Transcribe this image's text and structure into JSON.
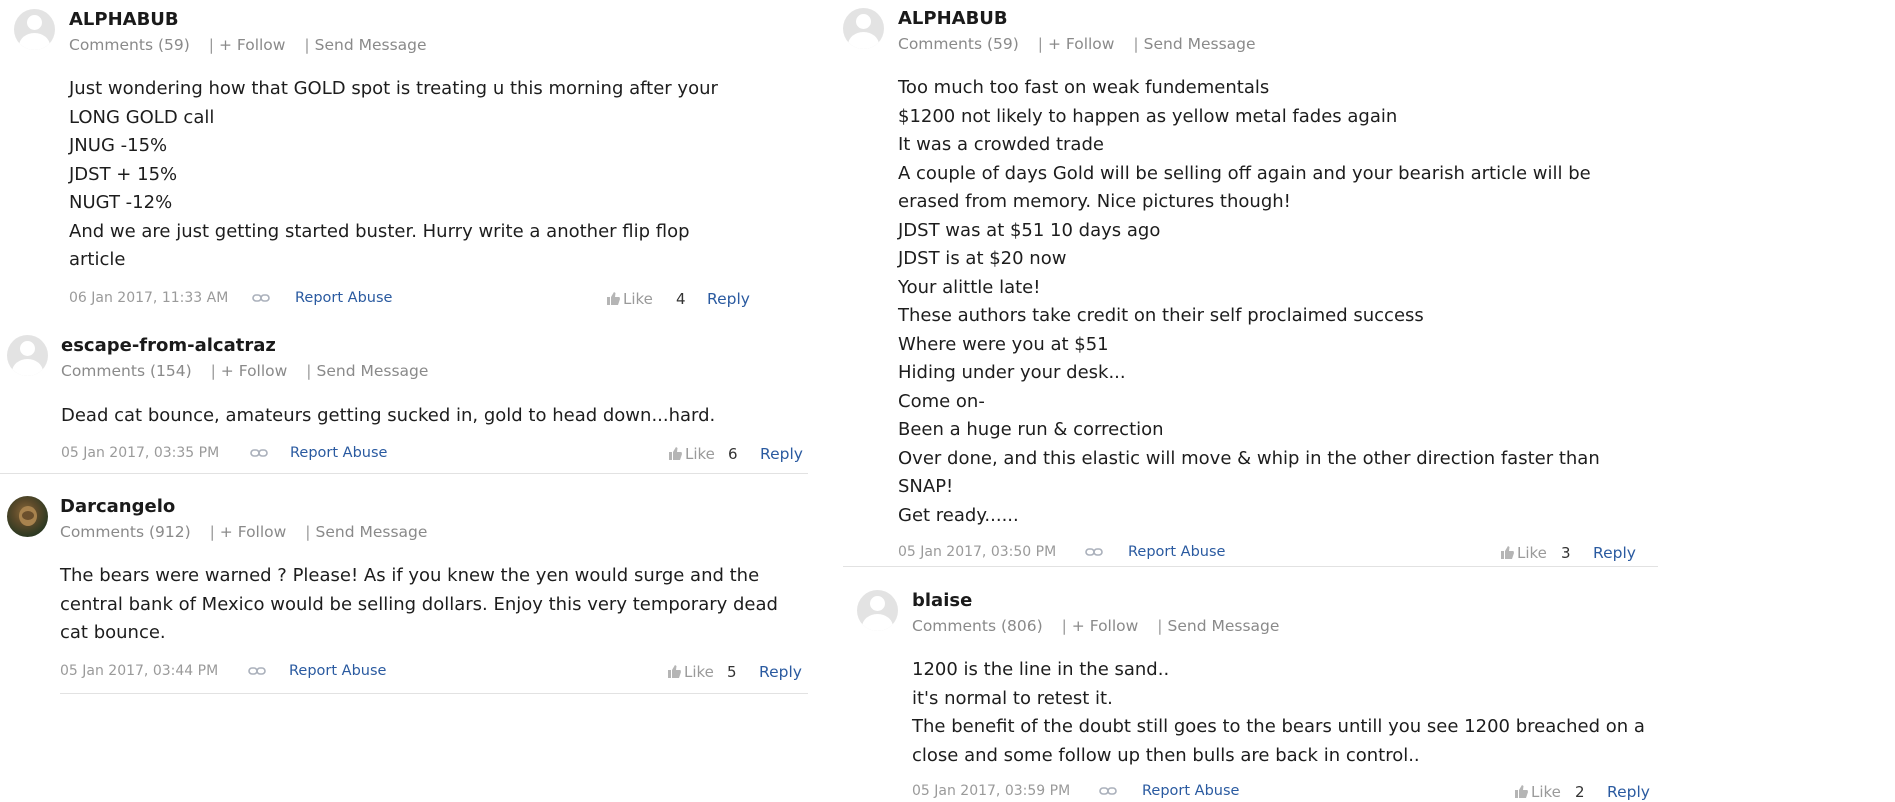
{
  "actions": {
    "follow": "+ Follow",
    "send_message": "Send Message",
    "report_abuse": "Report Abuse",
    "like": "Like",
    "reply": "Reply",
    "separator": "|"
  },
  "comments": [
    {
      "author": "ALPHABUB",
      "comment_count": "Comments (59)",
      "body": [
        "Just wondering how that GOLD spot is treating u this morning after your",
        "LONG GOLD call",
        "JNUG -15%",
        "JDST + 15%",
        "NUGT -12%",
        "And we are just getting started buster. Hurry write a another flip flop",
        "article"
      ],
      "timestamp": "06 Jan 2017, 11:33 AM",
      "likes": "4"
    },
    {
      "author": "escape-from-alcatraz",
      "comment_count": "Comments (154)",
      "body": [
        "Dead cat bounce, amateurs getting sucked in, gold to head down...hard."
      ],
      "timestamp": "05 Jan 2017, 03:35 PM",
      "likes": "6"
    },
    {
      "author": "Darcangelo",
      "comment_count": "Comments (912)",
      "body": [
        "The bears were warned ? Please! As if you knew the yen would surge and the",
        "central bank of Mexico would be selling dollars. Enjoy this very temporary dead",
        "cat bounce."
      ],
      "timestamp": "05 Jan 2017, 03:44 PM",
      "likes": "5"
    },
    {
      "author": "ALPHABUB",
      "comment_count": "Comments (59)",
      "body": [
        "Too much too fast on weak fundementals",
        "$1200 not likely to happen as yellow metal fades again",
        "It was a crowded trade",
        "A couple of days Gold will be selling off again and your bearish article will be",
        "erased from memory. Nice pictures though!",
        "JDST was at $51 10 days ago",
        "JDST is at $20 now",
        "Your alittle late!",
        "These authors take credit on their self proclaimed success",
        "Where were you at $51",
        "Hiding under your desk...",
        "Come on-",
        "Been a huge run & correction",
        "Over done, and this elastic will move & whip in the other direction faster than",
        "SNAP!",
        "Get ready......"
      ],
      "timestamp": "05 Jan 2017, 03:50 PM",
      "likes": "3"
    },
    {
      "author": "blaise",
      "comment_count": "Comments (806)",
      "body": [
        "1200 is the line in the sand..",
        "it's normal to retest it.",
        "The benefit of the doubt still goes to the bears untill you see 1200 breached on a",
        "close and some follow up then bulls are back in control.."
      ],
      "timestamp": "05 Jan 2017, 03:59 PM",
      "likes": "2"
    }
  ]
}
